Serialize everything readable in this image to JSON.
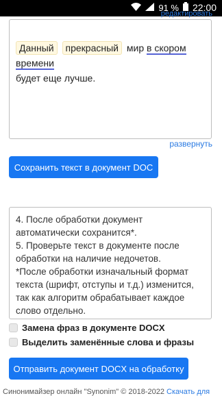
{
  "status_bar": {
    "battery": "91 %",
    "time": "22:00"
  },
  "editor": {
    "edit_link": "редактировать",
    "phrase1": "Данный",
    "phrase2": "прекрасный",
    "word_plain": "мир",
    "phrase3": "в скором времени",
    "line2": "будет еще лучше.",
    "expand_link": "развернуть"
  },
  "buttons": {
    "save_doc": "Сохранить текст в документ DOC",
    "send_docx": "Отправить документ DOCX на обработку"
  },
  "instructions": {
    "line_partial": "",
    "item4": "4. После обработки документ автоматически сохранится*.",
    "item5": "5. Проверьте текст в документе после обработки на наличие недочетов.",
    "note": "*После обработки изначальный формат текста (шрифт, отступы и т.д.) изменится, так как алгоритм обрабатывает каждое слово отдельно."
  },
  "options": {
    "replace_phrases": "Замена фраз в документе DOCX",
    "highlight_replaced": "Выделить заменённые слова и фразы"
  },
  "footer": {
    "text": "Синонимайзер онлайн \"Synonim\" © 2018-2022",
    "link": "Скачать для"
  }
}
